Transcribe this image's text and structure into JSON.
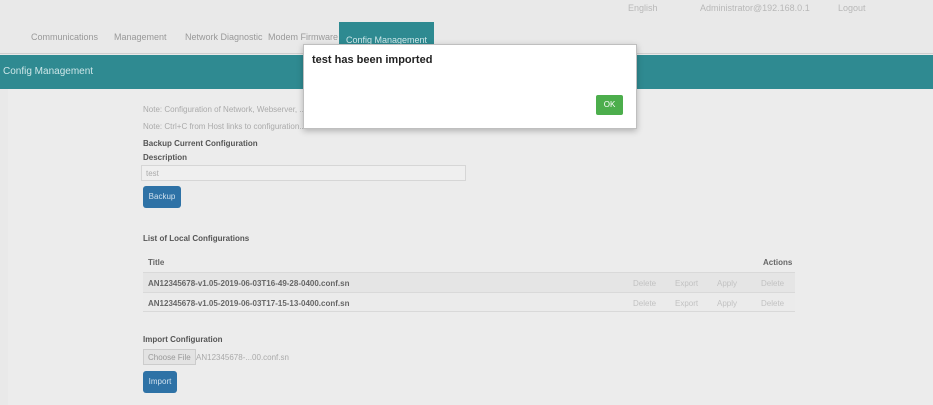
{
  "header": {
    "status_items": [
      "English",
      "Administrator@192.168.0.1",
      "Logout"
    ]
  },
  "nav": {
    "tabs": [
      {
        "label": "Communications"
      },
      {
        "label": "Management"
      },
      {
        "label": "Network Diagnostic"
      },
      {
        "label": "Modem Firmware"
      },
      {
        "label": "Config Management",
        "active": true
      }
    ]
  },
  "page": {
    "title": "Config Management"
  },
  "info": {
    "line1": "Note: Configuration of Network, Webserver, ...",
    "line2": "Note: Ctrl+C from Host links to configuration..."
  },
  "backup": {
    "heading": "Backup Current Configuration",
    "desc_label": "Description",
    "desc_value": "test",
    "button": "Backup"
  },
  "local_list": {
    "heading": "List of Local Configurations",
    "col_title": "Title",
    "col_actions": "Actions",
    "rows": [
      {
        "title": "AN12345678-v1.05-2019-06-03T16-49-28-0400.conf.sn",
        "actions": [
          "Delete",
          "Export",
          "Apply",
          "Delete"
        ]
      },
      {
        "title": "AN12345678-v1.05-2019-06-03T17-15-13-0400.conf.sn",
        "actions": [
          "Delete",
          "Export",
          "Apply",
          "Delete"
        ]
      }
    ]
  },
  "import": {
    "heading": "Import Configuration",
    "choose_button": "Choose File",
    "file_name": "AN12345678-...00.conf.sn",
    "button": "Import"
  },
  "modal": {
    "message": "test has been imported",
    "ok_label": "OK"
  },
  "colors": {
    "teal": "#2f8a91",
    "blue_button": "#2e72a6",
    "ok_green": "#4cae4c"
  }
}
